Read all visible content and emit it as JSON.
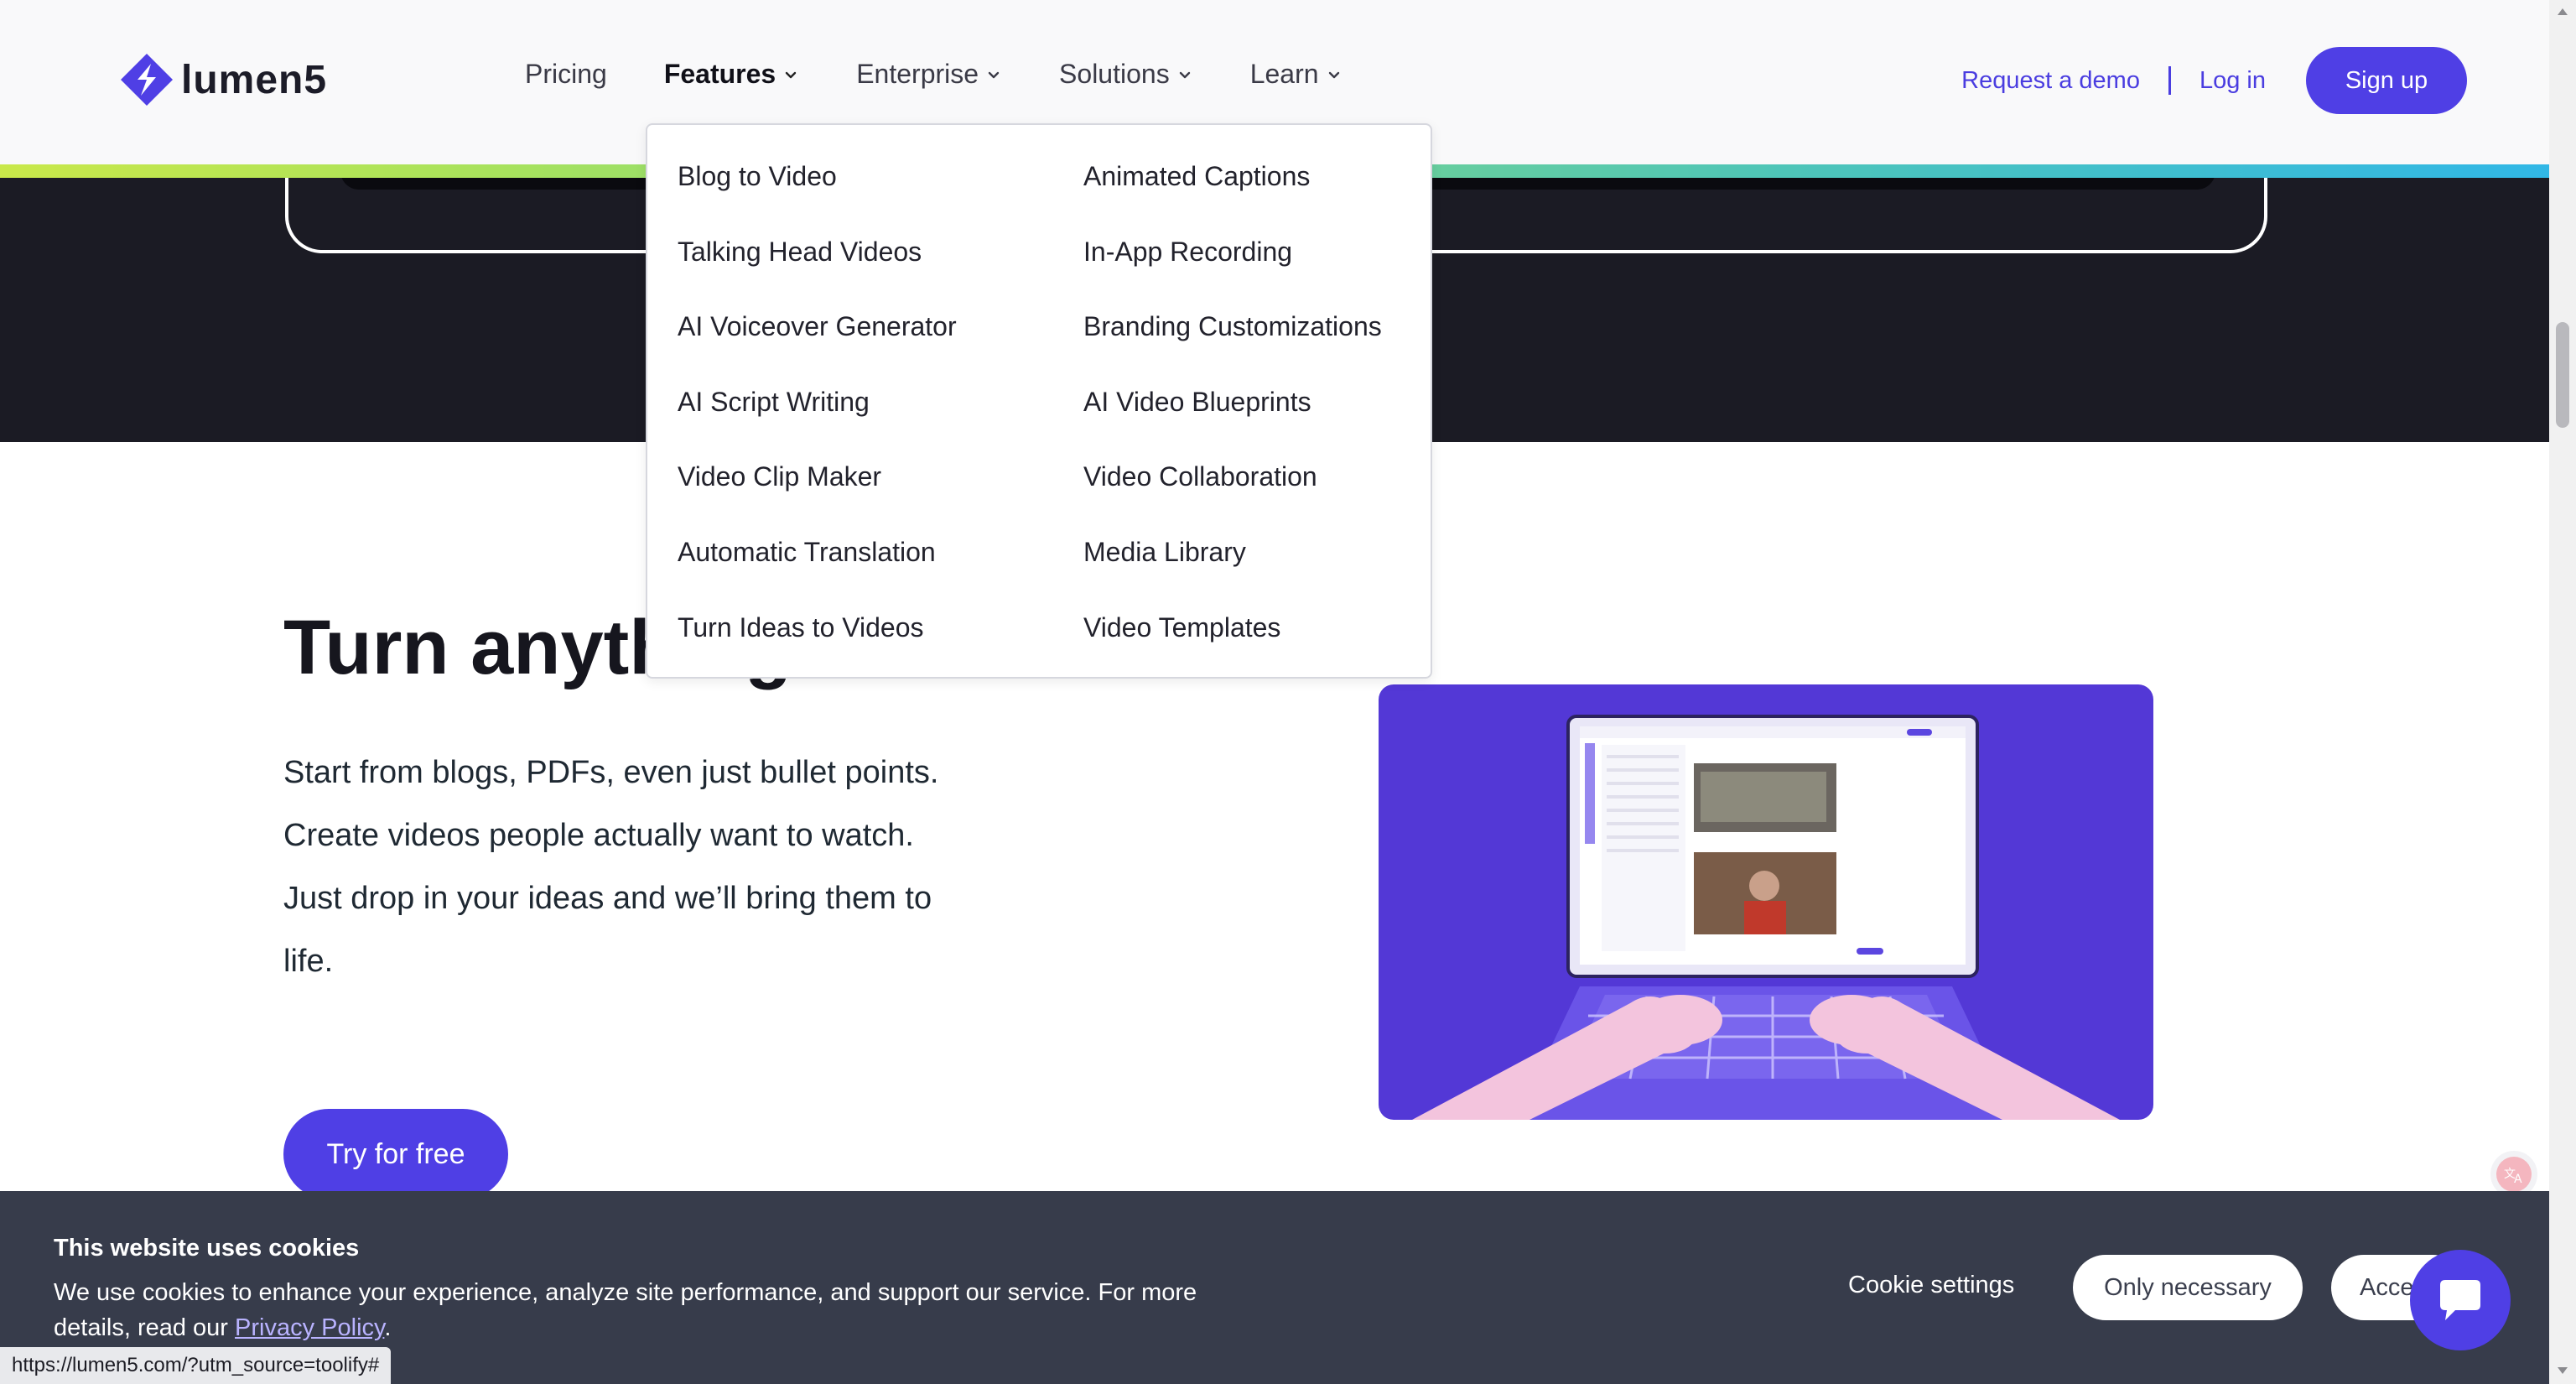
{
  "brand": {
    "name": "lumen5",
    "primary": "#4f3fe5"
  },
  "nav": {
    "items": [
      {
        "label": "Pricing",
        "dropdown": false
      },
      {
        "label": "Features",
        "dropdown": true,
        "active": true
      },
      {
        "label": "Enterprise",
        "dropdown": true
      },
      {
        "label": "Solutions",
        "dropdown": true
      },
      {
        "label": "Learn",
        "dropdown": true
      }
    ],
    "request_demo": "Request a demo",
    "login": "Log in",
    "signup": "Sign up"
  },
  "features_menu": {
    "col1": [
      "Blog to Video",
      "Talking Head Videos",
      "AI Voiceover Generator",
      "AI Script Writing",
      "Video Clip Maker",
      "Automatic Translation",
      "Turn Ideas to Videos"
    ],
    "col2": [
      "Animated Captions",
      "In-App Recording",
      "Branding Customizations",
      "AI Video Blueprints",
      "Video Collaboration",
      "Media Library",
      "Video Templates"
    ]
  },
  "main": {
    "heading": "Turn anything into video",
    "description": "Start from blogs, PDFs, even just bullet points.\nCreate videos people actually want to watch. Just drop in your ideas and we’ll bring them to life.",
    "cta": "Try for free"
  },
  "cookie": {
    "title": "This website uses cookies",
    "text": "We use cookies to enhance your experience, analyze site performance, and support our service. For more details, read our",
    "link": "Privacy Policy",
    "settings": "Cookie settings",
    "only_necessary": "Only necessary",
    "accept": "Accept"
  },
  "status_url": "https://lumen5.com/?utm_source=toolify#"
}
